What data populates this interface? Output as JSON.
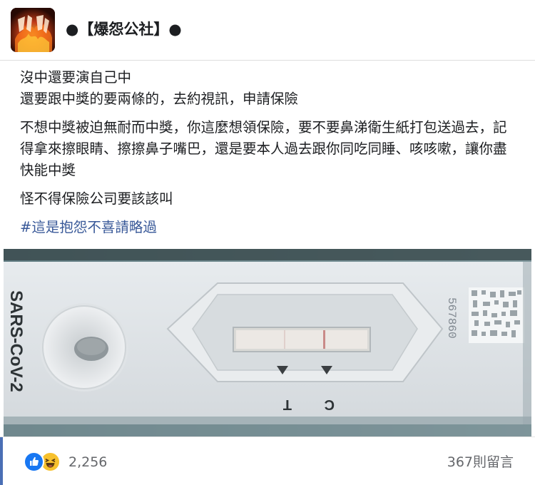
{
  "header": {
    "page_name": "●【爆怨公社】●"
  },
  "post": {
    "paragraphs": [
      "沒中還要演自己中\n還要跟中獎的要兩條的，去約視訊，申請保險",
      "不想中獎被迫無耐而中獎，你這麼想領保險，要不要鼻涕衛生紙打包送過去，記得拿來擦眼睛、擦擦鼻子嘴巴，還是要本人過去跟你同吃同睡、咳咳嗽，讓你盡快能中獎",
      "怪不得保險公司要該該叫"
    ],
    "hashtag": "#這是抱怨不喜請略過"
  },
  "photo": {
    "kit_brand": "SARS-CoV-2",
    "lot_number": "567860",
    "marker_c": "C",
    "marker_t": "T"
  },
  "footer": {
    "reactions": [
      "like-icon",
      "haha-icon"
    ],
    "reaction_count": "2,256",
    "comment_count": "367則留言"
  },
  "colors": {
    "hashtag": "#385898",
    "like_blue": "#1877f2",
    "haha_yellow": "#f7c12e",
    "muted_text": "#65676b"
  }
}
